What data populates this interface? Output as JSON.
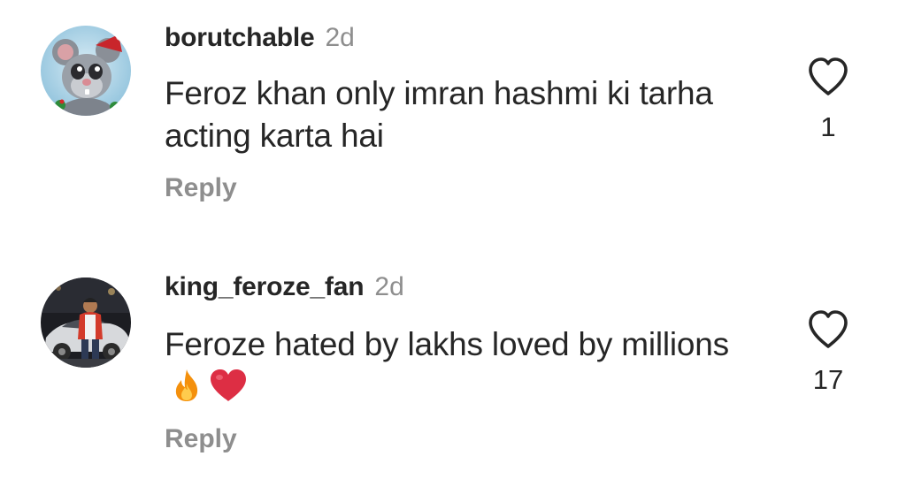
{
  "comments": [
    {
      "username": "borutchable",
      "time": "2d",
      "text": "Feroz khan only imran hashmi ki tarha acting karta hai",
      "emojis": [],
      "reply_label": "Reply",
      "likes": "1",
      "avatar_icon": "mouse-santa-hat-avatar"
    },
    {
      "username": "king_feroze_fan",
      "time": "2d",
      "text": "Feroze hated by lakhs loved by millions",
      "emojis": [
        "fire-emoji",
        "red-heart-emoji"
      ],
      "reply_label": "Reply",
      "likes": "17",
      "avatar_icon": "man-with-car-avatar"
    }
  ],
  "colors": {
    "primary_text": "#262626",
    "secondary_text": "#8e8e8e",
    "background": "#ffffff"
  }
}
